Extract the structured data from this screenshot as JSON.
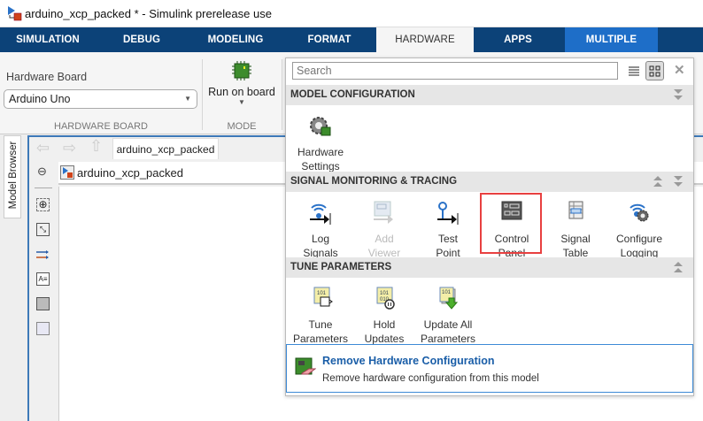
{
  "window": {
    "title": "arduino_xcp_packed * - Simulink prerelease use"
  },
  "tabs": [
    {
      "label": "SIMULATION"
    },
    {
      "label": "DEBUG"
    },
    {
      "label": "MODELING"
    },
    {
      "label": "FORMAT"
    },
    {
      "label": "HARDWARE",
      "active": true
    },
    {
      "label": "APPS"
    },
    {
      "label": "MULTIPLE"
    }
  ],
  "toolstrip": {
    "hardware_board_label": "Hardware Board",
    "hardware_board_value": "Arduino Uno",
    "hardware_board_group": "HARDWARE BOARD",
    "run_on_board": "Run on board",
    "mode_group": "MODE"
  },
  "editor": {
    "model_browser": "Model Browser",
    "tab": "arduino_xcp_packed",
    "address": "arduino_xcp_packed"
  },
  "gallery": {
    "search_placeholder": "Search",
    "sections": [
      {
        "title": "MODEL CONFIGURATION",
        "items": [
          {
            "line1": "Hardware",
            "line2": "Settings"
          }
        ]
      },
      {
        "title": "SIGNAL MONITORING & TRACING",
        "items": [
          {
            "line1": "Log",
            "line2": "Signals"
          },
          {
            "line1": "Add",
            "line2": "Viewer",
            "disabled": true
          },
          {
            "line1": "Test",
            "line2": "Point"
          },
          {
            "line1": "Control",
            "line2": "Panel",
            "highlighted": true
          },
          {
            "line1": "Signal",
            "line2": "Table"
          },
          {
            "line1": "Configure",
            "line2": "Logging"
          }
        ]
      },
      {
        "title": "TUNE PARAMETERS",
        "items": [
          {
            "line1": "Tune",
            "line2": "Parameters"
          },
          {
            "line1": "Hold",
            "line2": "Updates"
          },
          {
            "line1": "Update All",
            "line2": "Parameters"
          }
        ]
      }
    ],
    "remove": {
      "title": "Remove Hardware Configuration",
      "description": "Remove hardware configuration from this model"
    }
  },
  "colors": {
    "tabbar": "#0c4278",
    "highlight": "#e84040",
    "link": "#1a5ea8"
  }
}
